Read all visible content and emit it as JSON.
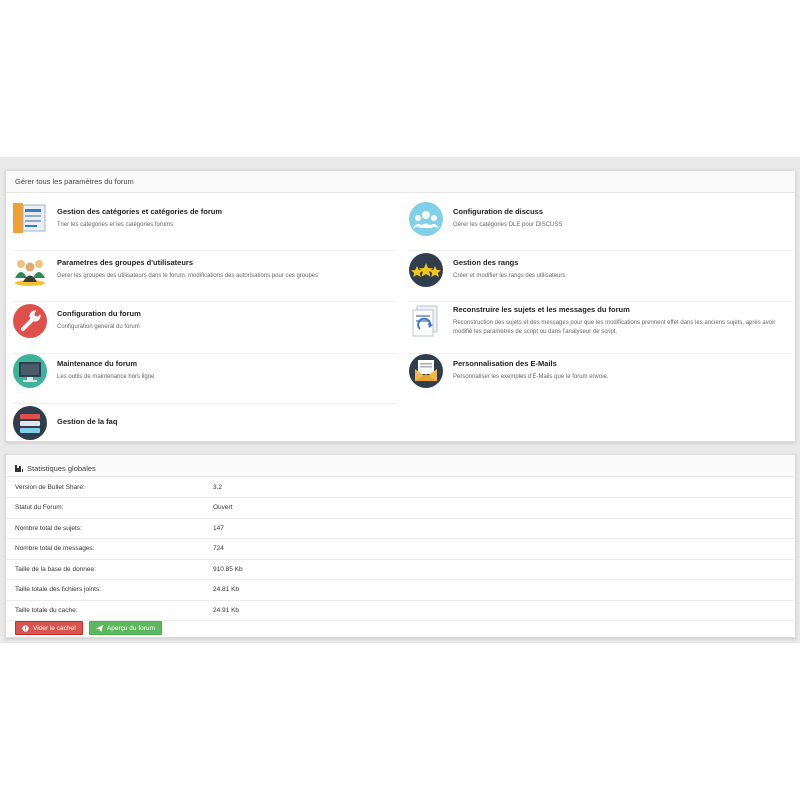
{
  "settings_panel": {
    "title": "Gérer tous les paramètres du forum",
    "items": [
      {
        "icon": "folder-docs-icon",
        "title": "Gestion des catégories et catégories de forum",
        "desc": "Trier les categories et les catégories forums"
      },
      {
        "icon": "discuss-users-icon",
        "title": "Configuration de discuss",
        "desc": "Gérer les catégories DLE pour DISCUSS"
      },
      {
        "icon": "user-group-icon",
        "title": "Parametres des groupes d'utilisateurs",
        "desc": "Gerer les groupes des utilisateurs dans le forum, modifications des autorisations pour ces groupes"
      },
      {
        "icon": "stars-icon",
        "title": "Gestion des rangs",
        "desc": "Créer et modifier les rangs des utilisateurs"
      },
      {
        "icon": "wrench-icon",
        "title": "Configuration du forum",
        "desc": "Configuration general du forum"
      },
      {
        "icon": "rebuild-docs-icon",
        "title": "Reconstruire les sujets et les messages du forum",
        "desc": "Reconstruction des sujets et des messages pour que les modifications prennent effet dans les anciens sujets, après avoir modifié les paramètres de script ou dans l'analyseur de script."
      },
      {
        "icon": "monitor-icon",
        "title": "Maintenance du forum",
        "desc": "Les outils de maintenance hors ligne"
      },
      {
        "icon": "envelope-icon",
        "title": "Personnalisation des E-Mails",
        "desc": "Personnaliser les exemples d'E-Mails que le forum envoie."
      },
      {
        "icon": "faq-list-icon",
        "title": "Gestion de la faq",
        "desc": ""
      }
    ]
  },
  "stats_panel": {
    "title": "Statistiques globales",
    "rows": [
      {
        "label": "Version de Bullet Share:",
        "value": "3.2"
      },
      {
        "label": "Statut du Forum:",
        "value": "Ouvert"
      },
      {
        "label": "Nombre total de sujets:",
        "value": "147"
      },
      {
        "label": "Nombre total de messages:",
        "value": "724"
      },
      {
        "label": "Taille de la base de donnee:",
        "value": "910.85 Kb"
      },
      {
        "label": "Taille totale des fichiers joints:",
        "value": "24.81 Kb"
      },
      {
        "label": "Taille totale du cache:",
        "value": "24.91 Kb"
      }
    ],
    "buttons": {
      "clear_cache": "Vider le cache!",
      "preview": "Aperçu du forum"
    }
  },
  "colors": {
    "danger": "#d9534f",
    "success": "#5cb85c",
    "band": "#e9e9ea"
  }
}
